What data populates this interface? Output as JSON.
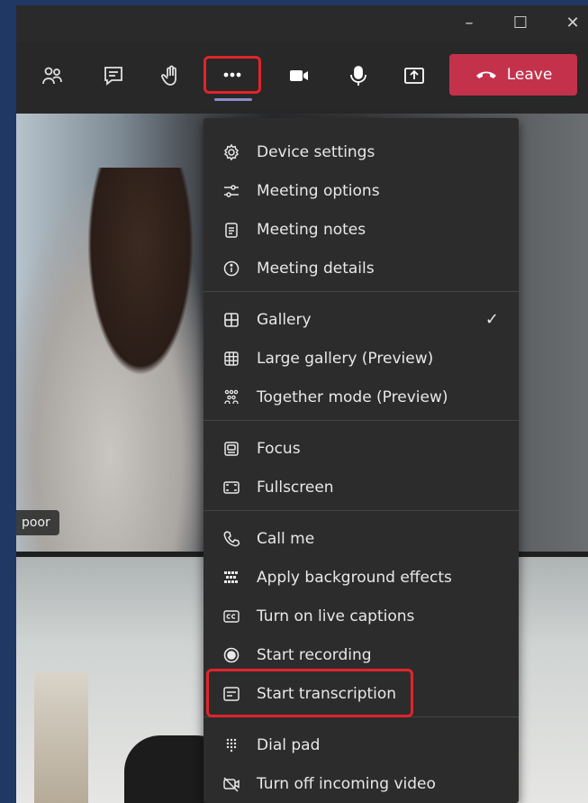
{
  "toolbar": {
    "icons": [
      "participants-icon",
      "chat-icon",
      "raise-hand-icon",
      "more-actions-icon",
      "camera-icon",
      "microphone-icon",
      "share-icon"
    ],
    "leave_label": "Leave"
  },
  "video": {
    "name_tag": "poor"
  },
  "menu": {
    "items": [
      {
        "label": "Device settings",
        "icon": "gear-icon"
      },
      {
        "label": "Meeting options",
        "icon": "sliders-icon"
      },
      {
        "label": "Meeting notes",
        "icon": "notes-icon"
      },
      {
        "label": "Meeting details",
        "icon": "info-icon"
      },
      {
        "label": "Gallery",
        "icon": "gallery-icon",
        "checked": true
      },
      {
        "label": "Large gallery (Preview)",
        "icon": "large-gallery-icon"
      },
      {
        "label": "Together mode (Preview)",
        "icon": "together-mode-icon"
      },
      {
        "label": "Focus",
        "icon": "focus-icon"
      },
      {
        "label": "Fullscreen",
        "icon": "fullscreen-icon"
      },
      {
        "label": "Call me",
        "icon": "phone-icon"
      },
      {
        "label": "Apply background effects",
        "icon": "background-effects-icon"
      },
      {
        "label": "Turn on live captions",
        "icon": "captions-icon"
      },
      {
        "label": "Start recording",
        "icon": "record-icon"
      },
      {
        "label": "Start transcription",
        "icon": "transcription-icon"
      },
      {
        "label": "Dial pad",
        "icon": "dialpad-icon"
      },
      {
        "label": "Turn off incoming video",
        "icon": "video-off-icon"
      }
    ]
  },
  "colors": {
    "leave": "#c4314b",
    "highlight": "#e1242b",
    "menu_bg": "#2d2c2c",
    "page_bg": "#1f3864"
  }
}
